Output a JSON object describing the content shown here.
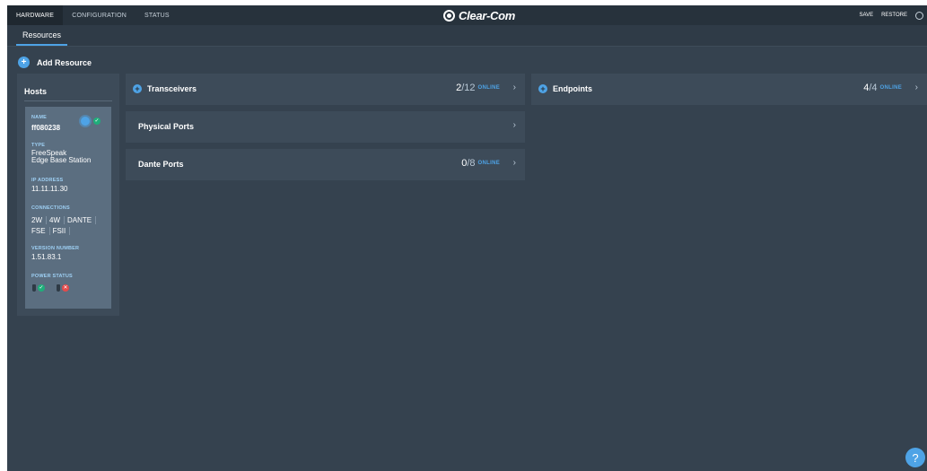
{
  "topbar": {
    "tabs": [
      {
        "label": "HARDWARE",
        "active": true
      },
      {
        "label": "CONFIGURATION",
        "active": false
      },
      {
        "label": "STATUS",
        "active": false
      }
    ],
    "brand": "Clear-Com",
    "actions": {
      "save": "SAVE",
      "restore": "RESTORE"
    }
  },
  "subnav": {
    "tab": "Resources"
  },
  "add_resource": {
    "label": "Add Resource",
    "icon": "plus-circle-icon"
  },
  "hosts": {
    "title": "Hosts",
    "card": {
      "name_label": "NAME",
      "name": "ff080238",
      "type_label": "TYPE",
      "type_line1": "FreeSpeak",
      "type_line2": "Edge Base Station",
      "ip_label": "IP ADDRESS",
      "ip": "11.11.11.30",
      "connections_label": "CONNECTIONS",
      "connections": [
        "2W",
        "4W",
        "DANTE",
        "FSE",
        "FSII"
      ],
      "version_label": "VERSION NUMBER",
      "version": "1.51.83.1",
      "power_label": "POWER STATUS",
      "power": [
        {
          "status": "ok"
        },
        {
          "status": "error"
        }
      ]
    }
  },
  "resources": {
    "transceivers": {
      "name": "Transceivers",
      "online": "2",
      "total": "/12",
      "status": "ONLINE"
    },
    "physical_ports": {
      "name": "Physical Ports"
    },
    "dante_ports": {
      "name": "Dante Ports",
      "online": "0",
      "total": "/8",
      "status": "ONLINE"
    },
    "endpoints": {
      "name": "Endpoints",
      "online": "4",
      "total": "/4",
      "status": "ONLINE"
    }
  },
  "help": {
    "label": "?"
  },
  "colors": {
    "accent": "#4ea3e6",
    "ok": "#1fae7a",
    "error": "#e34b4b",
    "background": "#35424f"
  }
}
